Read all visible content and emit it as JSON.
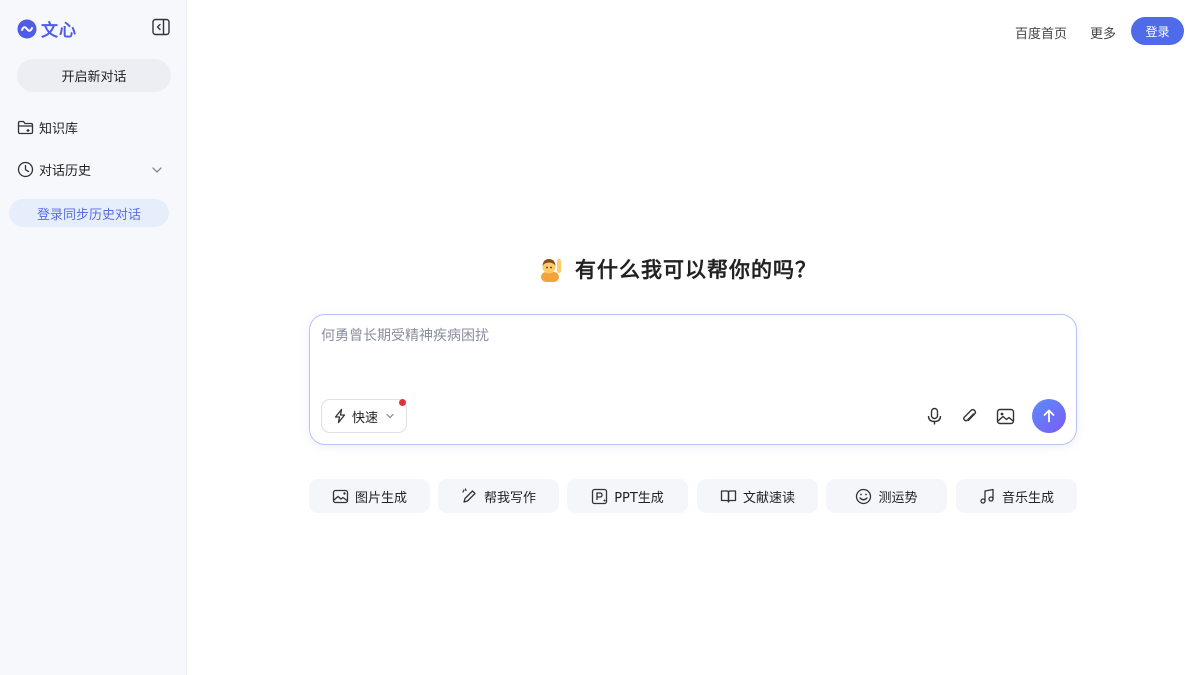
{
  "sidebar": {
    "logo_text": "文心",
    "new_chat_label": "开启新对话",
    "knowledge_base_label": "知识库",
    "history_label": "对话历史",
    "login_sync_label": "登录同步历史对话"
  },
  "header": {
    "baidu_home": "百度首页",
    "more": "更多",
    "login": "登录"
  },
  "main": {
    "greeting": "有什么我可以帮你的吗？",
    "input_placeholder": "何勇曾长期受精神疾病困扰",
    "mode_label": "快速",
    "quick_actions": [
      {
        "label": "图片生成",
        "icon": "image-gen-icon"
      },
      {
        "label": "帮我写作",
        "icon": "pen-icon"
      },
      {
        "label": "PPT生成",
        "icon": "ppt-icon"
      },
      {
        "label": "文献速读",
        "icon": "book-icon"
      },
      {
        "label": "测运势",
        "icon": "fortune-icon"
      },
      {
        "label": "音乐生成",
        "icon": "music-icon"
      }
    ]
  },
  "colors": {
    "brand": "#4f5ce8",
    "login_button": "#4f6bea",
    "sync_text": "#5a6ee0",
    "notification_dot": "#e0323a"
  }
}
